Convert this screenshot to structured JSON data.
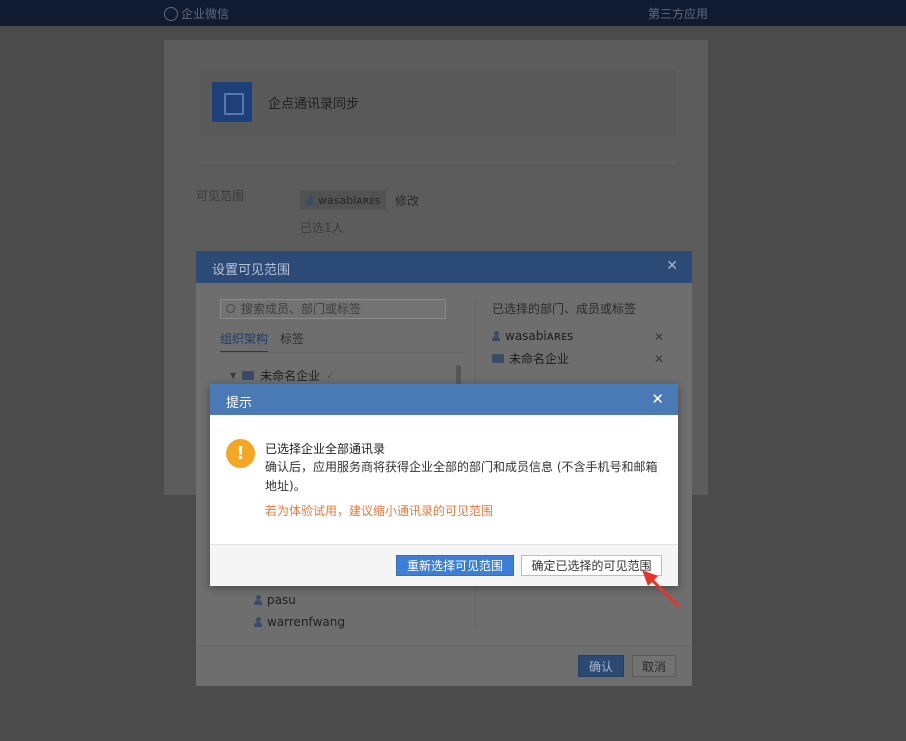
{
  "topbar": {
    "logo_label": "企业微信",
    "right_label": "第三方应用"
  },
  "app": {
    "name": "企点通讯录同步"
  },
  "scope": {
    "label": "可见范围",
    "chip_user": "wasabiᴀʀᴇs",
    "edit_label": "修改",
    "count_text": "已选1人"
  },
  "modal": {
    "title": "设置可见范围",
    "search_placeholder": "搜索成员、部门或标签",
    "tabs": [
      "组织架构",
      "标签"
    ],
    "tree_root": "未命名企业",
    "members": [
      "pasu",
      "warrenfwang"
    ],
    "selected_title": "已选择的部门、成员或标签",
    "selected": [
      {
        "type": "user",
        "label": "wasabiᴀʀᴇs"
      },
      {
        "type": "folder",
        "label": "未命名企业"
      }
    ],
    "ok_label": "确认",
    "cancel_label": "取消"
  },
  "alert": {
    "title": "提示",
    "main": "已选择企业全部通讯录",
    "desc": "确认后，应用服务商将获得企业全部的部门和成员信息 (不含手机号和邮箱地址)。",
    "tip": "若为体验试用，建议缩小通讯录的可见范围",
    "reselect_label": "重新选择可见范围",
    "confirm_label": "确定已选择的可见范围"
  },
  "colors": {
    "alert_header": "#4a7ab5",
    "primary_button": "#3c7fd6",
    "tip_text": "#e8793b",
    "warn_icon": "#f5a623",
    "arrow": "#e8332a"
  }
}
